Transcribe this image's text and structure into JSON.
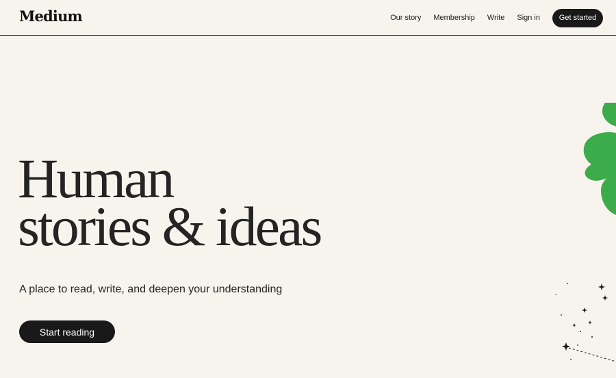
{
  "header": {
    "logo": "Medium",
    "nav": [
      "Our story",
      "Membership",
      "Write",
      "Sign in"
    ],
    "cta": "Get started"
  },
  "hero": {
    "title_line1": "Human",
    "title_line2": "stories & ideas",
    "subtitle": "A place to read, write, and deepen your understanding",
    "button": "Start reading"
  },
  "illustration": {
    "shape_icon": "clover-illustration",
    "shape_color": "#3cab4a",
    "sparkle_icon": "sparkles-illustration"
  },
  "colors": {
    "background": "#f7f4ed",
    "text": "#242424",
    "button_bg": "#191919",
    "button_text": "#ffffff"
  }
}
